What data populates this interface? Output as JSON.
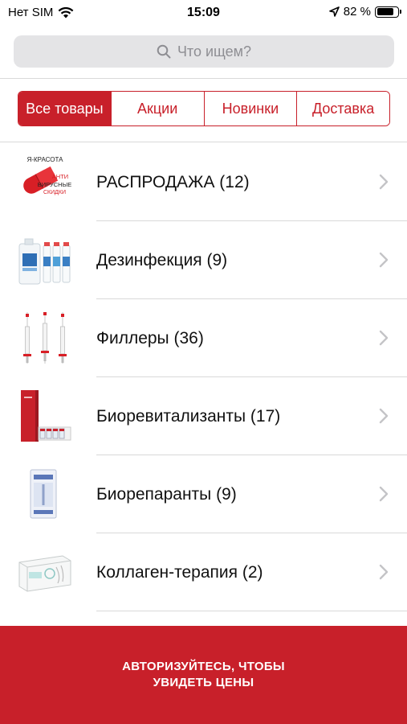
{
  "status_bar": {
    "carrier": "Нет SIM",
    "time": "15:09",
    "battery_percent": "82 %",
    "battery_level": 0.82,
    "icons": [
      "wifi-icon",
      "location-arrow-icon",
      "battery-icon"
    ]
  },
  "search": {
    "placeholder": "Что ищем?",
    "icon": "search-icon"
  },
  "tabs": [
    {
      "label": "Все товары",
      "active": true
    },
    {
      "label": "Акции",
      "active": false
    },
    {
      "label": "Новинки",
      "active": false
    },
    {
      "label": "Доставка",
      "active": false
    }
  ],
  "categories": [
    {
      "label": "РАСПРОДАЖА (12)",
      "thumb": "sale-banner-thumbnail",
      "thumb_text": [
        "Я-КРАСОТА",
        "АНТИ",
        "ВИРУСНЫЕ",
        "СКИДКИ"
      ]
    },
    {
      "label": "Дезинфекция (9)",
      "thumb": "disinfectant-bottles-thumbnail"
    },
    {
      "label": "Филлеры (36)",
      "thumb": "filler-syringes-thumbnail"
    },
    {
      "label": "Биоревитализанты (17)",
      "thumb": "biorevitalizant-box-thumbnail"
    },
    {
      "label": "Биорепаранты (9)",
      "thumb": "bioreparant-package-thumbnail"
    },
    {
      "label": "Коллаген-терапия (2)",
      "thumb": "collagen-box-thumbnail"
    }
  ],
  "cta": {
    "line1": "АВТОРИЗУЙТЕСЬ, ЧТОБЫ",
    "line2": "УВИДЕТЬ ЦЕНЫ"
  },
  "colors": {
    "accent": "#c8202a",
    "search_bg": "#e4e4e6",
    "separator": "#d9d9d9",
    "chevron": "#c4c4c7"
  }
}
